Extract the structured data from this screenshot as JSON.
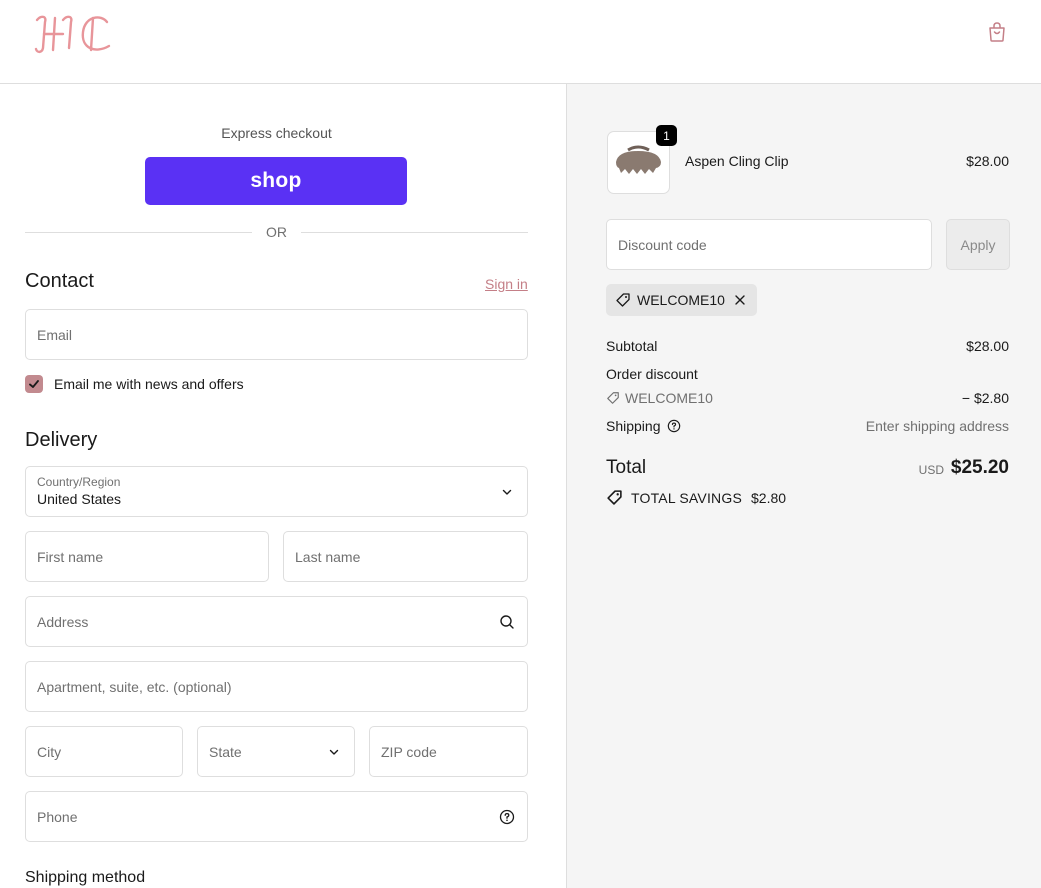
{
  "header": {
    "logo_text": "HC",
    "bag_icon": "shopping-bag-icon"
  },
  "express": {
    "label": "Express checkout",
    "shop_button": "shop",
    "or": "OR"
  },
  "contact": {
    "title": "Contact",
    "sign_in": "Sign in",
    "email_placeholder": "Email",
    "newsletter_label": "Email me with news and offers",
    "newsletter_checked": true
  },
  "delivery": {
    "title": "Delivery",
    "country_label": "Country/Region",
    "country_value": "United States",
    "first_name": "First name",
    "last_name": "Last name",
    "address": "Address",
    "apartment": "Apartment, suite, etc. (optional)",
    "city": "City",
    "state": "State",
    "zip": "ZIP code",
    "phone": "Phone",
    "shipping_method": "Shipping method"
  },
  "summary": {
    "item": {
      "quantity": "1",
      "name": "Aspen Cling Clip",
      "price": "$28.00"
    },
    "discount_placeholder": "Discount code",
    "apply": "Apply",
    "applied_code": "WELCOME10",
    "subtotal_label": "Subtotal",
    "subtotal_value": "$28.00",
    "order_discount_label": "Order discount",
    "discount_code": "WELCOME10",
    "discount_value": "− $2.80",
    "shipping_label": "Shipping",
    "shipping_value": "Enter shipping address",
    "total_label": "Total",
    "currency": "USD",
    "total_value": "$25.20",
    "savings_label": "TOTAL SAVINGS",
    "savings_value": "$2.80"
  },
  "colors": {
    "accent": "#c47f87",
    "shop_purple": "#5a31f4"
  }
}
